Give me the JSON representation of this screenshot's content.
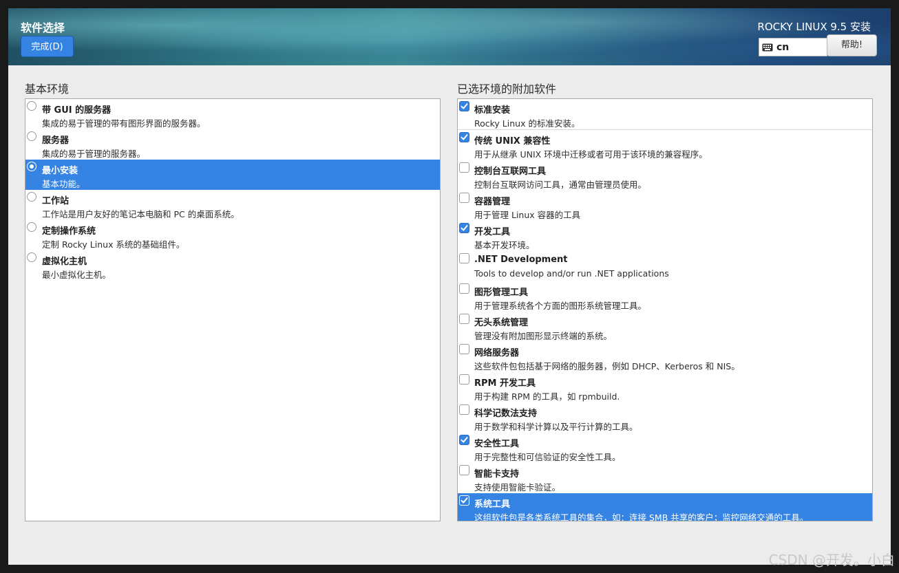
{
  "header": {
    "title": "软件选择",
    "done_label": "完成(D)",
    "product": "ROCKY LINUX 9.5 安装",
    "keyboard_layout": "cn",
    "help_label": "帮助!"
  },
  "base_env": {
    "label": "基本环境",
    "items": [
      {
        "title": "带 GUI 的服务器",
        "desc": "集成的易于管理的带有图形界面的服务器。",
        "selected": false
      },
      {
        "title": "服务器",
        "desc": "集成的易于管理的服务器。",
        "selected": false
      },
      {
        "title": "最小安装",
        "desc": "基本功能。",
        "selected": true
      },
      {
        "title": "工作站",
        "desc": "工作站是用户友好的笔记本电脑和 PC 的桌面系统。",
        "selected": false
      },
      {
        "title": "定制操作系统",
        "desc": "定制 Rocky Linux 系统的基础组件。",
        "selected": false
      },
      {
        "title": "虚拟化主机",
        "desc": "最小虚拟化主机。",
        "selected": false
      }
    ]
  },
  "addons": {
    "label": "已选环境的附加软件",
    "items": [
      {
        "title": "标准安装",
        "desc": "Rocky Linux 的标准安装。",
        "checked": true
      },
      {
        "title": "传统 UNIX 兼容性",
        "desc": "用于从继承 UNIX 环境中迁移或者可用于该环境的兼容程序。",
        "checked": true
      },
      {
        "title": "控制台互联网工具",
        "desc": "控制台互联网访问工具，通常由管理员使用。",
        "checked": false
      },
      {
        "title": "容器管理",
        "desc": "用于管理 Linux 容器的工具",
        "checked": false
      },
      {
        "title": "开发工具",
        "desc": "基本开发环境。",
        "checked": true
      },
      {
        "title": ".NET Development",
        "desc": "Tools to develop and/or run .NET applications",
        "checked": false
      },
      {
        "title": "图形管理工具",
        "desc": "用于管理系统各个方面的图形系统管理工具。",
        "checked": false
      },
      {
        "title": "无头系统管理",
        "desc": "管理没有附加图形显示终端的系统。",
        "checked": false
      },
      {
        "title": "网络服务器",
        "desc": "这些软件包包括基于网络的服务器，例如 DHCP、Kerberos 和 NIS。",
        "checked": false
      },
      {
        "title": "RPM 开发工具",
        "desc": "用于构建 RPM 的工具，如 rpmbuild.",
        "checked": false
      },
      {
        "title": "科学记数法支持",
        "desc": "用于数学和科学计算以及平行计算的工具。",
        "checked": false
      },
      {
        "title": "安全性工具",
        "desc": "用于完整性和可信验证的安全性工具。",
        "checked": true
      },
      {
        "title": "智能卡支持",
        "desc": "支持使用智能卡验证。",
        "checked": false
      },
      {
        "title": "系统工具",
        "desc": "这组软件包是各类系统工具的集合，如：连接 SMB 共享的客户；监控网络交通的工具。",
        "checked": true,
        "selected": true
      }
    ]
  },
  "watermark": "CSDN @开发。小白",
  "colors": {
    "accent": "#3584e4"
  }
}
